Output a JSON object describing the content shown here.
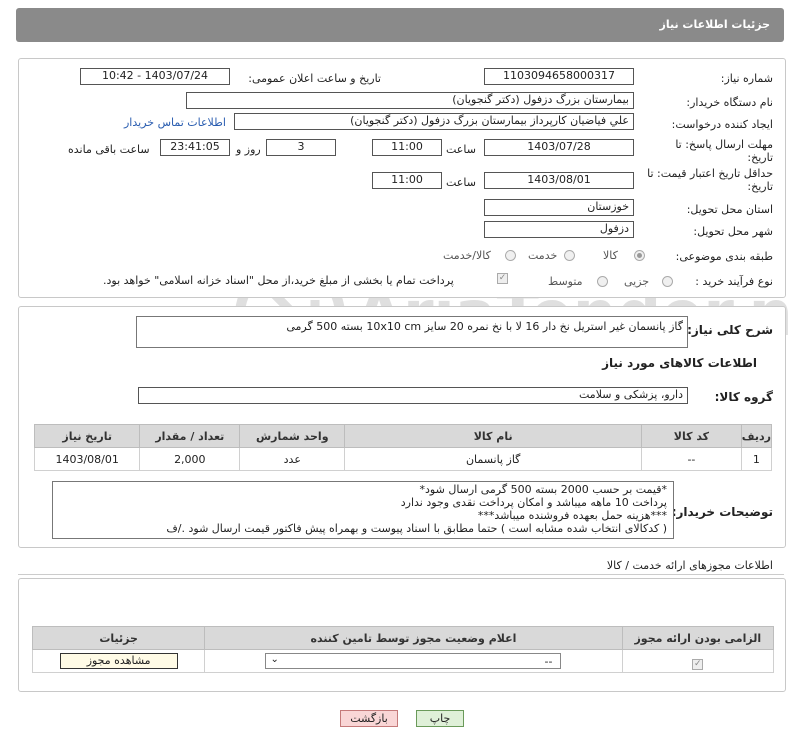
{
  "header": {
    "title": "جزئیات اطلاعات نیاز"
  },
  "form": {
    "need_number_label": "شماره نیاز:",
    "need_number": "1103094658000317",
    "announce_label": "تاریخ و ساعت اعلان عمومی:",
    "announce_value": "1403/07/24 - 10:42",
    "buyer_org_label": "نام دستگاه خریدار:",
    "buyer_org": "بیمارستان بزرگ دزفول (دکتر گنجویان)",
    "creator_label": "ایجاد کننده درخواست:",
    "creator": "علي فياضيان كارپرداز بیمارستان بزرگ دزفول (دکتر گنجویان)",
    "contact_link": "اطلاعات تماس خریدار",
    "deadline_label": "مهلت ارسال پاسخ: تا تاریخ:",
    "deadline_date": "1403/07/28",
    "time_label": "ساعت",
    "deadline_time": "11:00",
    "days_value": "3",
    "days_label": "روز و",
    "remaining_time": "23:41:05",
    "remaining_label": "ساعت باقی مانده",
    "validity_label": "حداقل تاریخ اعتبار قیمت: تا تاریخ:",
    "validity_date": "1403/08/01",
    "validity_time": "11:00",
    "province_label": "استان محل تحویل:",
    "province": "خوزستان",
    "city_label": "شهر محل تحویل:",
    "city": "دزفول",
    "category_label": "طبقه بندی موضوعی:",
    "category_options": [
      "کالا",
      "خدمت",
      "کالا/خدمت"
    ],
    "process_label": "نوع فرآیند خرید :",
    "process_options": [
      "جزیی",
      "متوسط"
    ],
    "payment_note": "پرداخت تمام یا بخشی از مبلغ خرید،از محل \"اسناد خزانه اسلامی\" خواهد بود."
  },
  "description": {
    "label": "شرح کلی نیاز:",
    "text": "گاز پانسمان غیر استریل نخ دار 16 لا با نخ نمره 20 سایز 10x10 cm بسته 500 گرمی"
  },
  "goods": {
    "section_title": "اطلاعات کالاهای مورد نیاز",
    "group_label": "گروه کالا:",
    "group_value": "دارو، پزشکی و سلامت",
    "columns": [
      "ردیف",
      "کد کالا",
      "نام کالا",
      "واحد شمارش",
      "تعداد / مقدار",
      "تاریخ نیاز"
    ],
    "rows": [
      {
        "idx": "1",
        "code": "--",
        "name": "گاز پانسمان",
        "unit": "عدد",
        "qty": "2,000",
        "date": "1403/08/01"
      }
    ],
    "buyer_notes_label": "توضیحات خریدار:",
    "buyer_notes": [
      "*قیمت بر حسب 2000 بسته 500 گرمی ارسال شود*",
      "پرداخت 10 ماهه میباشد و امکان پرداخت نقدی وجود ندارد",
      "***هزینه حمل بعهده فروشنده میباشد***",
      "( کدکالای انتخاب شده مشابه است ) حتما مطابق با اسناد پیوست و بهمراه پیش فاکتور قیمت ارسال شود ./ف"
    ]
  },
  "permits": {
    "section_title": "اطلاعات مجوزهای ارائه خدمت / کالا",
    "columns": [
      "الزامی بودن ارائه مجوز",
      "اعلام وضعیت مجوز توسط تامین کننده",
      "جزئیات"
    ],
    "select_value": "--",
    "view_button": "مشاهده مجوز"
  },
  "footer": {
    "print_button": "چاپ",
    "back_button": "بازگشت"
  },
  "watermark": {
    "text": "AriaTender.neT"
  },
  "colors": {
    "header": "#8a8a8a",
    "link": "#2a5db0",
    "table_header": "#d9d9d9",
    "back_button": "#f9d6d6",
    "print_button": "#dff0d8"
  }
}
